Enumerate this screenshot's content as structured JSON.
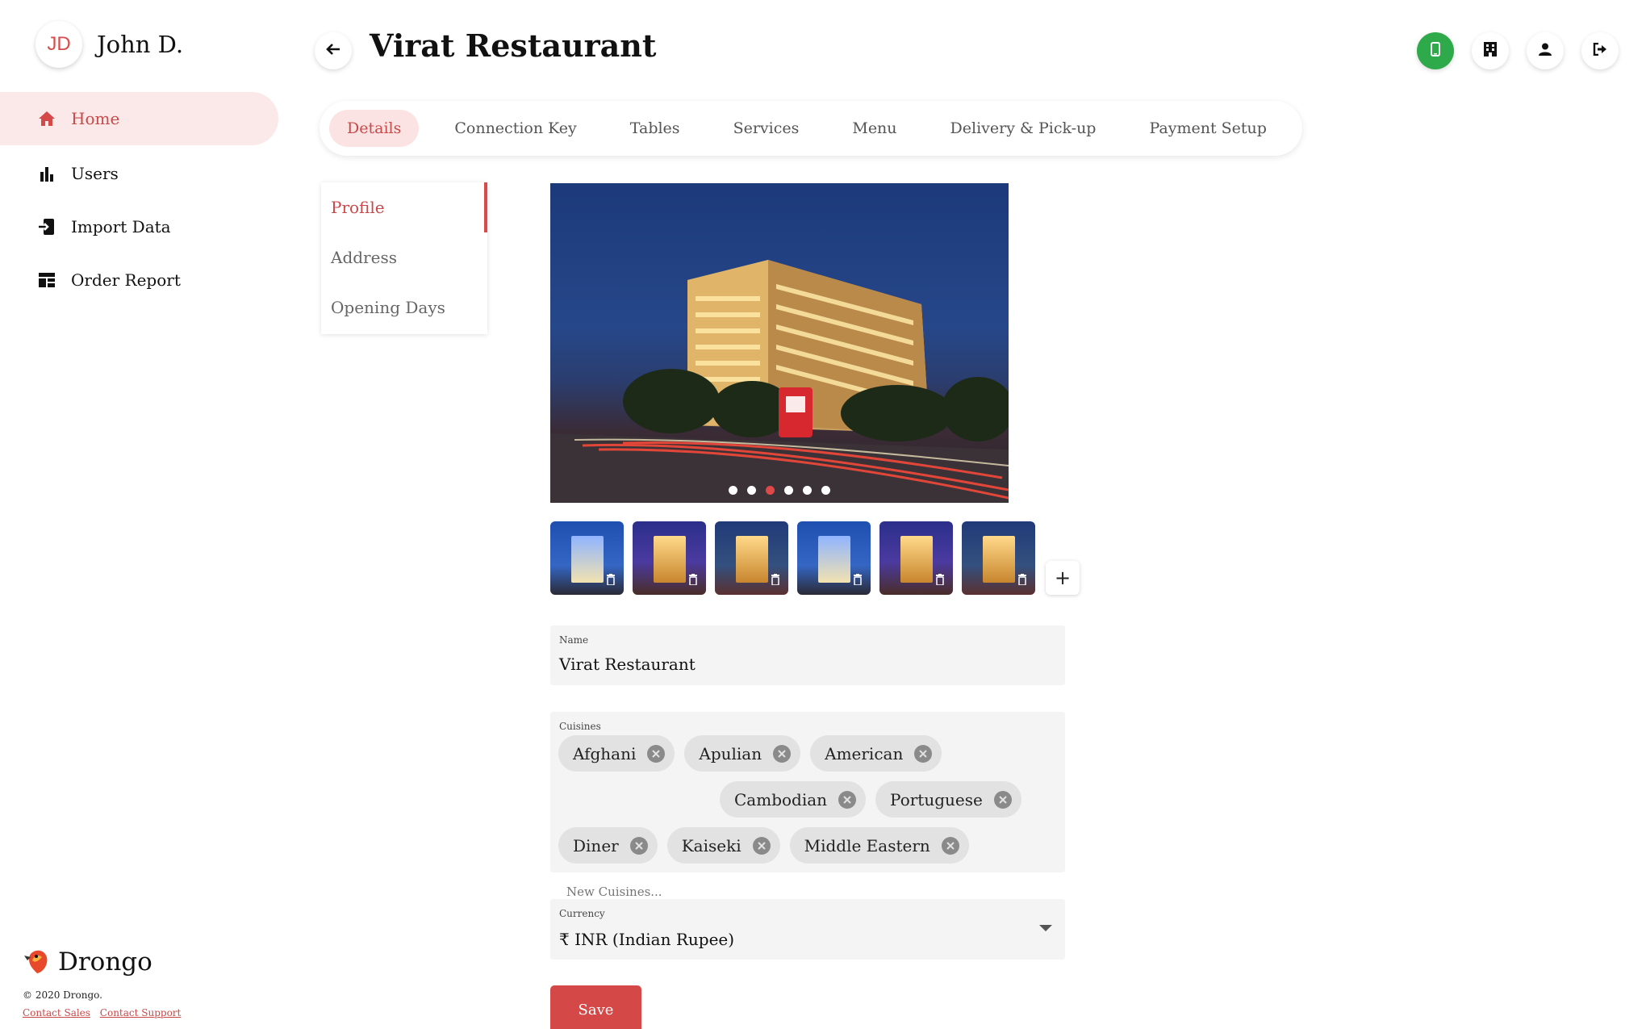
{
  "user": {
    "initials": "JD",
    "name": "John D."
  },
  "sidebar": {
    "items": [
      {
        "label": "Home",
        "icon": "home-icon",
        "active": true
      },
      {
        "label": "Users",
        "icon": "bar-chart-icon"
      },
      {
        "label": "Import Data",
        "icon": "import-icon"
      },
      {
        "label": "Order Report",
        "icon": "dashboard-icon"
      }
    ]
  },
  "brand": {
    "name": "Drongo",
    "copyright": "© 2020 Drongo.",
    "contact_sales": "Contact Sales",
    "contact_support": "Contact Support"
  },
  "header": {
    "title": "Virat Restaurant",
    "actions": [
      "mobile-icon",
      "building-icon",
      "person-icon",
      "logout-icon"
    ],
    "accent_green": "#2faa4a"
  },
  "tabs": [
    {
      "label": "Details",
      "active": true
    },
    {
      "label": "Connection Key"
    },
    {
      "label": "Tables"
    },
    {
      "label": "Services"
    },
    {
      "label": "Menu"
    },
    {
      "label": "Delivery & Pick-up"
    },
    {
      "label": "Payment Setup"
    }
  ],
  "subnav": [
    {
      "label": "Profile",
      "active": true
    },
    {
      "label": "Address"
    },
    {
      "label": "Opening Days"
    }
  ],
  "gallery": {
    "slide_count": 6,
    "active_slide": 3,
    "thumbnail_count": 6
  },
  "form": {
    "name_label": "Name",
    "name_value": "Virat Restaurant",
    "cuisines_label": "Cuisines",
    "cuisines": [
      "Afghani",
      "Apulian",
      "American",
      "Cambodian",
      "Portuguese",
      "Diner",
      "Kaiseki",
      "Middle Eastern"
    ],
    "new_cuisine_placeholder": "New Cuisines...",
    "currency_label": "Currency",
    "currency_value": "₹ INR (Indian Rupee)",
    "save_label": "Save"
  },
  "colors": {
    "accent": "#d44848",
    "accent_light": "#fbe3e3",
    "field_bg": "#f4f4f5"
  }
}
